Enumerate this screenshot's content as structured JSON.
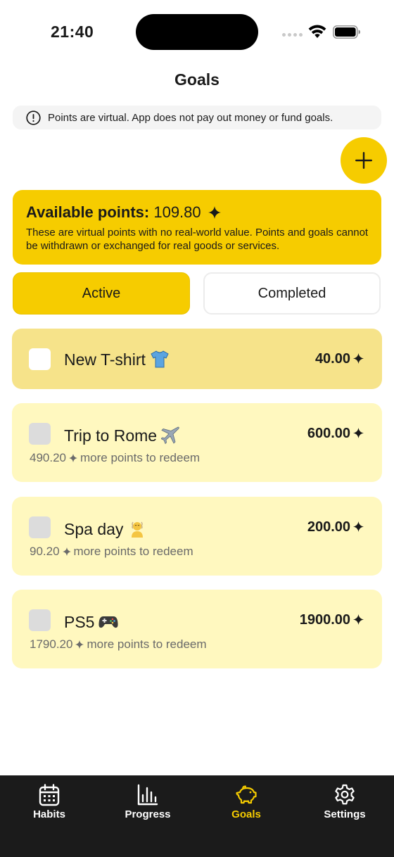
{
  "status_bar": {
    "time": "21:40"
  },
  "header": {
    "title": "Goals"
  },
  "notice": {
    "text": "Points are virtual. App does not pay out money or fund goals."
  },
  "points": {
    "label": "Available points:",
    "value": "109.80",
    "description": "These are virtual points with no real-world value. Points and goals cannot be withdrawn or exchanged for real goods or services."
  },
  "tabs": [
    {
      "label": "Active",
      "selected": true
    },
    {
      "label": "Completed",
      "selected": false
    }
  ],
  "goals": [
    {
      "title": "New T-shirt",
      "emoji": "t-shirt",
      "price": "40.00",
      "remaining": null
    },
    {
      "title": "Trip to Rome",
      "emoji": "airplane",
      "price": "600.00",
      "remaining": "490.20",
      "remaining_suffix": "more points to redeem"
    },
    {
      "title": "Spa day",
      "emoji": "person-in-steamy-room",
      "price": "200.00",
      "remaining": "90.20",
      "remaining_suffix": "more points to redeem"
    },
    {
      "title": "PS5",
      "emoji": "video-game",
      "price": "1900.00",
      "remaining": "1790.20",
      "remaining_suffix": "more points to redeem"
    }
  ],
  "nav": [
    {
      "label": "Habits",
      "icon": "calendar-icon"
    },
    {
      "label": "Progress",
      "icon": "bar-chart-icon"
    },
    {
      "label": "Goals",
      "icon": "piggy-bank-icon",
      "active": true
    },
    {
      "label": "Settings",
      "icon": "gear-icon"
    }
  ],
  "colors": {
    "accent": "#f6cc00",
    "card": "#fff8bf",
    "card_highlight": "#f6e38a",
    "tabbar": "#1b1b1b"
  }
}
